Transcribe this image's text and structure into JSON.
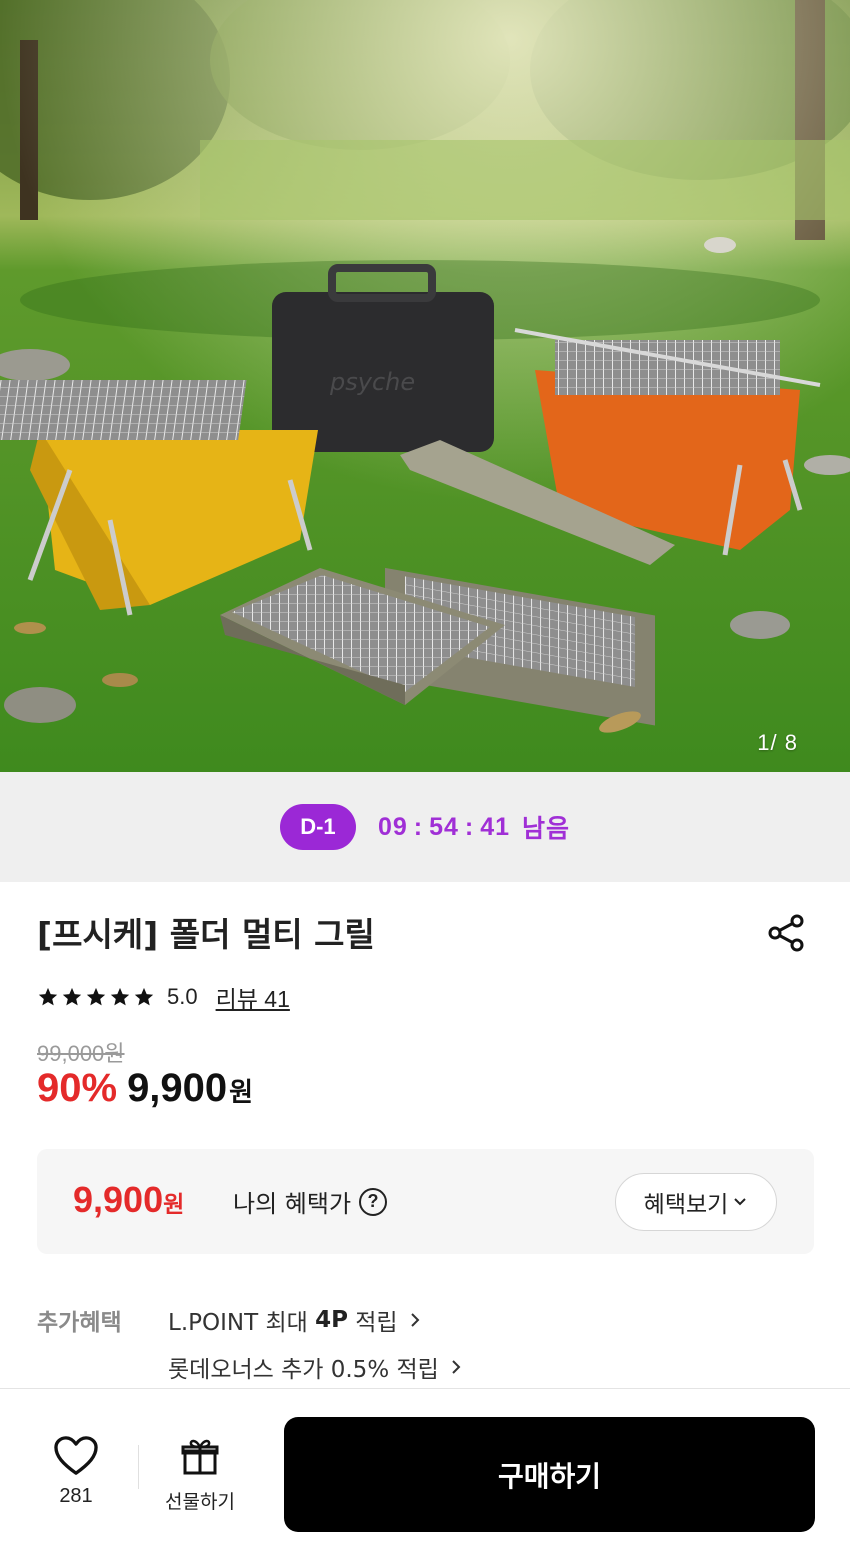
{
  "hero": {
    "image_counter": "1/ 8",
    "grill_brand_text": "psyche"
  },
  "timer": {
    "badge": "D-1",
    "hours": "09",
    "minutes": "54",
    "seconds": "41",
    "separator": ":",
    "suffix": "남음"
  },
  "product": {
    "title": "[프시케] 폴더 멀티 그릴",
    "rating": {
      "stars": 5,
      "score": "5.0",
      "review_label": "리뷰 41"
    },
    "original_price": "99,000원",
    "discount": "90%",
    "sale_price": "9,900",
    "currency": "원"
  },
  "benefit": {
    "price": "9,900",
    "currency": "원",
    "label": "나의 혜택가",
    "help_glyph": "?",
    "button_label": "혜택보기"
  },
  "extra_benefits": {
    "label": "추가혜택",
    "lines": [
      {
        "prefix": "L.POINT 최대 ",
        "bold": "4P",
        "suffix": " 적립"
      },
      {
        "prefix": "롯데오너스 추가 0.5% 적립",
        "bold": "",
        "suffix": ""
      }
    ]
  },
  "bottom_bar": {
    "wish_count": "281",
    "gift_label": "선물하기",
    "buy_label": "구매하기"
  },
  "colors": {
    "purple_badge": "#9b28d6",
    "timer_text": "#a02fd6",
    "discount_red": "#e42a2a",
    "buy_button": "#000000"
  },
  "icons": [
    "share-icon",
    "star-icon",
    "question-icon",
    "chevron-down-icon",
    "chevron-right-icon",
    "heart-icon",
    "gift-icon"
  ]
}
